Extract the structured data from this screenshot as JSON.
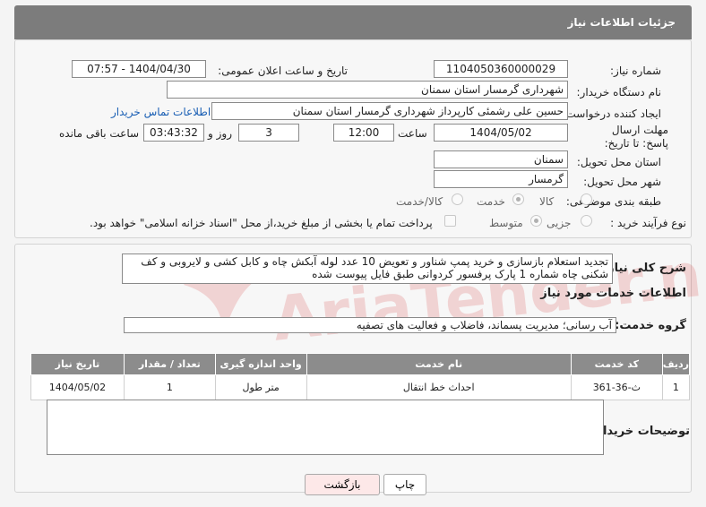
{
  "header": {
    "title": "جزئیات اطلاعات نیاز"
  },
  "form": {
    "need_number_label": "شماره نیاز:",
    "need_number": "1104050360000029",
    "announce_label": "تاریخ و ساعت اعلان عمومی:",
    "announce_value": "1404/04/30 - 07:57",
    "buyer_org_label": "نام دستگاه خریدار:",
    "buyer_org": "شهرداری گرمسار استان سمنان",
    "creator_label": "ایجاد کننده درخواست:",
    "creator": "حسین علی رشمئی کارپرداز شهرداری گرمسار استان سمنان",
    "buyer_contact_link": "اطلاعات تماس خریدار",
    "deadline_label": "مهلت ارسال پاسخ: تا تاریخ:",
    "deadline_date": "1404/05/02",
    "time_label": "ساعت",
    "deadline_time": "12:00",
    "days_value": "3",
    "days_label": "روز و",
    "remaining_time": "03:43:32",
    "remaining_label": "ساعت باقی مانده",
    "province_label": "استان محل تحویل:",
    "province": "سمنان",
    "city_label": "شهر محل تحویل:",
    "city": "گرمسار",
    "category_label": "طبقه بندی موضوعی:",
    "category_options": [
      "کالا",
      "خدمت",
      "کالا/خدمت"
    ],
    "category_selected": "خدمت",
    "process_label": "نوع فرآیند خرید :",
    "process_options": [
      "جزیی",
      "متوسط"
    ],
    "process_selected": "متوسط",
    "payment_note": "پرداخت تمام یا بخشی از مبلغ خرید،از محل \"اسناد خزانه اسلامی\" خواهد بود."
  },
  "summary": {
    "label": "شرح کلی نیاز:",
    "text": "تجدید استعلام بازسازی و خرید پمپ شناور و تعویض 10 عدد لوله آبکش چاه و کابل کشی و لایروبی و کف شکنی چاه شماره 1 پارک پرفسور کردوانی طبق فایل پیوست شده"
  },
  "services": {
    "section_title": "اطلاعات خدمات مورد نیاز",
    "group_label": "گروه خدمت:",
    "group_value": "آب رسانی؛ مدیریت پسماند، فاضلاب و فعالیت های تصفیه",
    "columns": [
      "ردیف",
      "کد خدمت",
      "نام خدمت",
      "واحد اندازه گیری",
      "تعداد / مقدار",
      "تاریخ نیاز"
    ],
    "rows": [
      [
        "1",
        "ث-36-361",
        "احداث خط انتقال",
        "متر طول",
        "1",
        "1404/05/02"
      ]
    ]
  },
  "buyer_notes": {
    "label": "توضیحات خریدار:",
    "value": ""
  },
  "buttons": {
    "print": "چاپ",
    "back": "بازگشت"
  },
  "watermark": {
    "text": "AriaTender.neT"
  },
  "colors": {
    "header_bg": "#7c7c7c",
    "link": "#1a5fb4",
    "table_header": "#8c8c8c",
    "back_btn": "#fde8e8"
  }
}
